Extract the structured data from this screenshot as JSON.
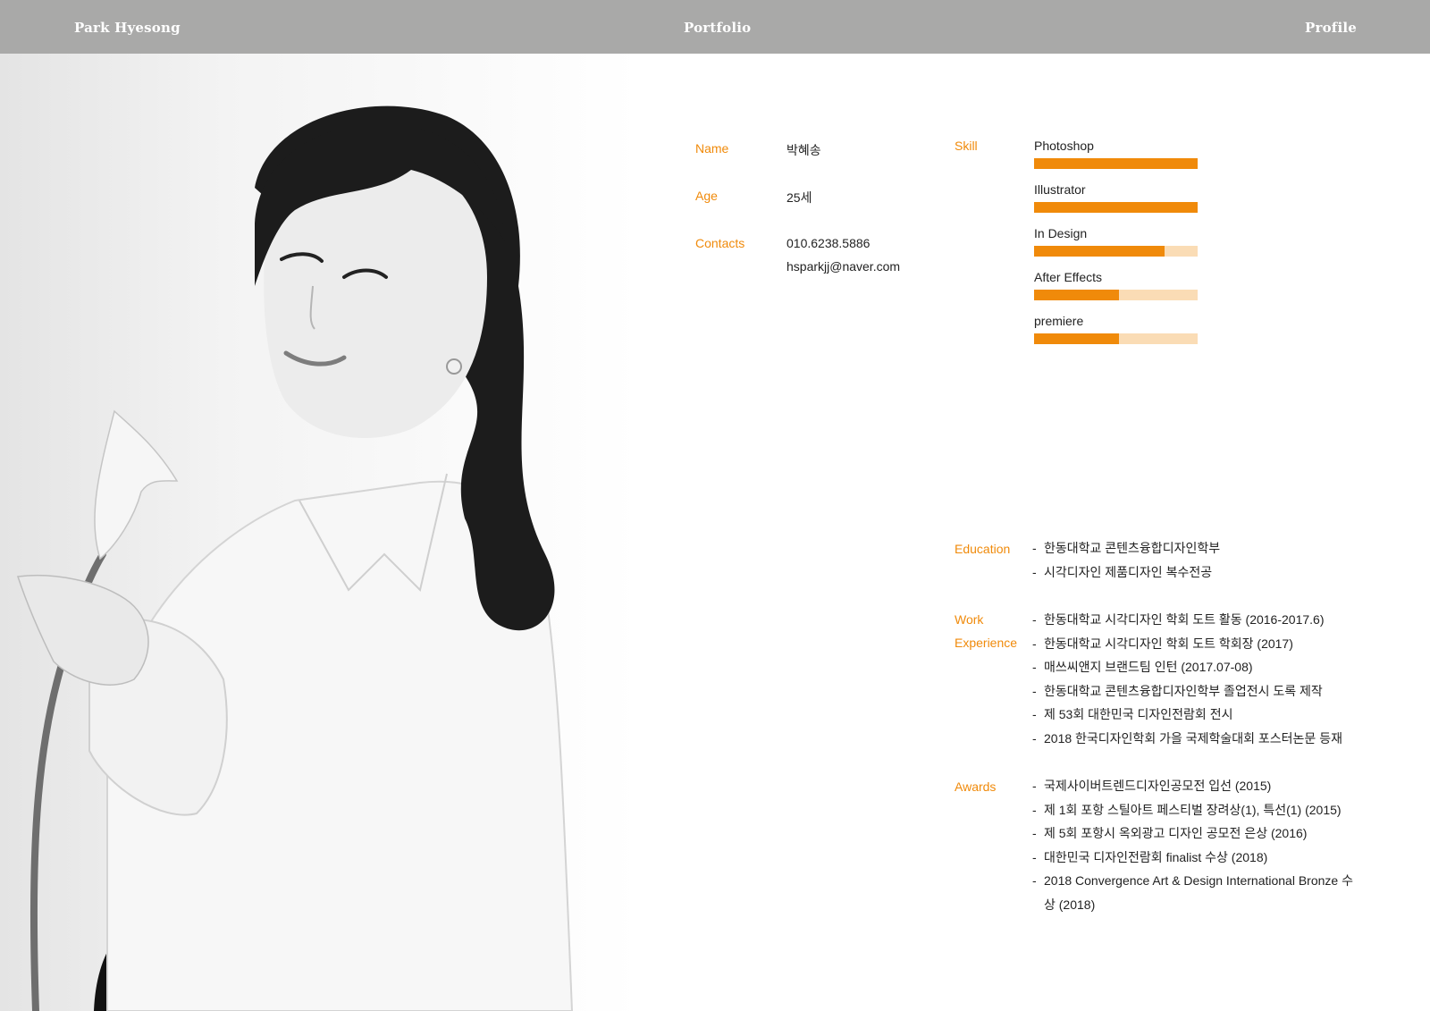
{
  "header": {
    "left": "Park Hyesong",
    "center": "Portfolio",
    "right": "Profile"
  },
  "profile": {
    "name_label": "Name",
    "name_value": "박혜송",
    "age_label": "Age",
    "age_value": "25세",
    "contacts_label": "Contacts",
    "phone": "010.6238.5886",
    "email": "hsparkjj@naver.com"
  },
  "skills": {
    "label": "Skill",
    "items": [
      {
        "name": "Photoshop",
        "level": 1.0
      },
      {
        "name": "Illustrator",
        "level": 1.0
      },
      {
        "name": "In Design",
        "level": 0.8
      },
      {
        "name": "After Effects",
        "level": 0.52
      },
      {
        "name": "premiere",
        "level": 0.52
      }
    ]
  },
  "education": {
    "label": "Education",
    "items": [
      "한동대학교 콘텐츠융합디자인학부",
      "시각디자인 제품디자인 복수전공"
    ]
  },
  "work": {
    "label_line1": "Work",
    "label_line2": "Experience",
    "items": [
      "한동대학교 시각디자인 학회 도트 활동 (2016-2017.6)",
      "한동대학교 시각디자인 학회 도트 학회장 (2017)",
      "매쓰씨앤지 브랜드팀 인턴 (2017.07-08)",
      "한동대학교 콘텐츠융합디자인학부 졸업전시 도록 제작",
      "제 53회 대한민국 디자인전람회 전시",
      "2018 한국디자인학회 가을 국제학술대회 포스터논문 등재"
    ]
  },
  "awards": {
    "label": "Awards",
    "items": [
      "국제사이버트렌드디자인공모전 입선 (2015)",
      "제 1회 포항 스틸아트 페스티벌 장려상(1), 특선(1) (2015)",
      "제 5회 포항시 옥외광고 디자인 공모전 은상 (2016)",
      "대한민국 디자인전람회 finalist 수상 (2018)",
      "2018 Convergence Art & Design International Bronze 수상 (2018)"
    ]
  }
}
